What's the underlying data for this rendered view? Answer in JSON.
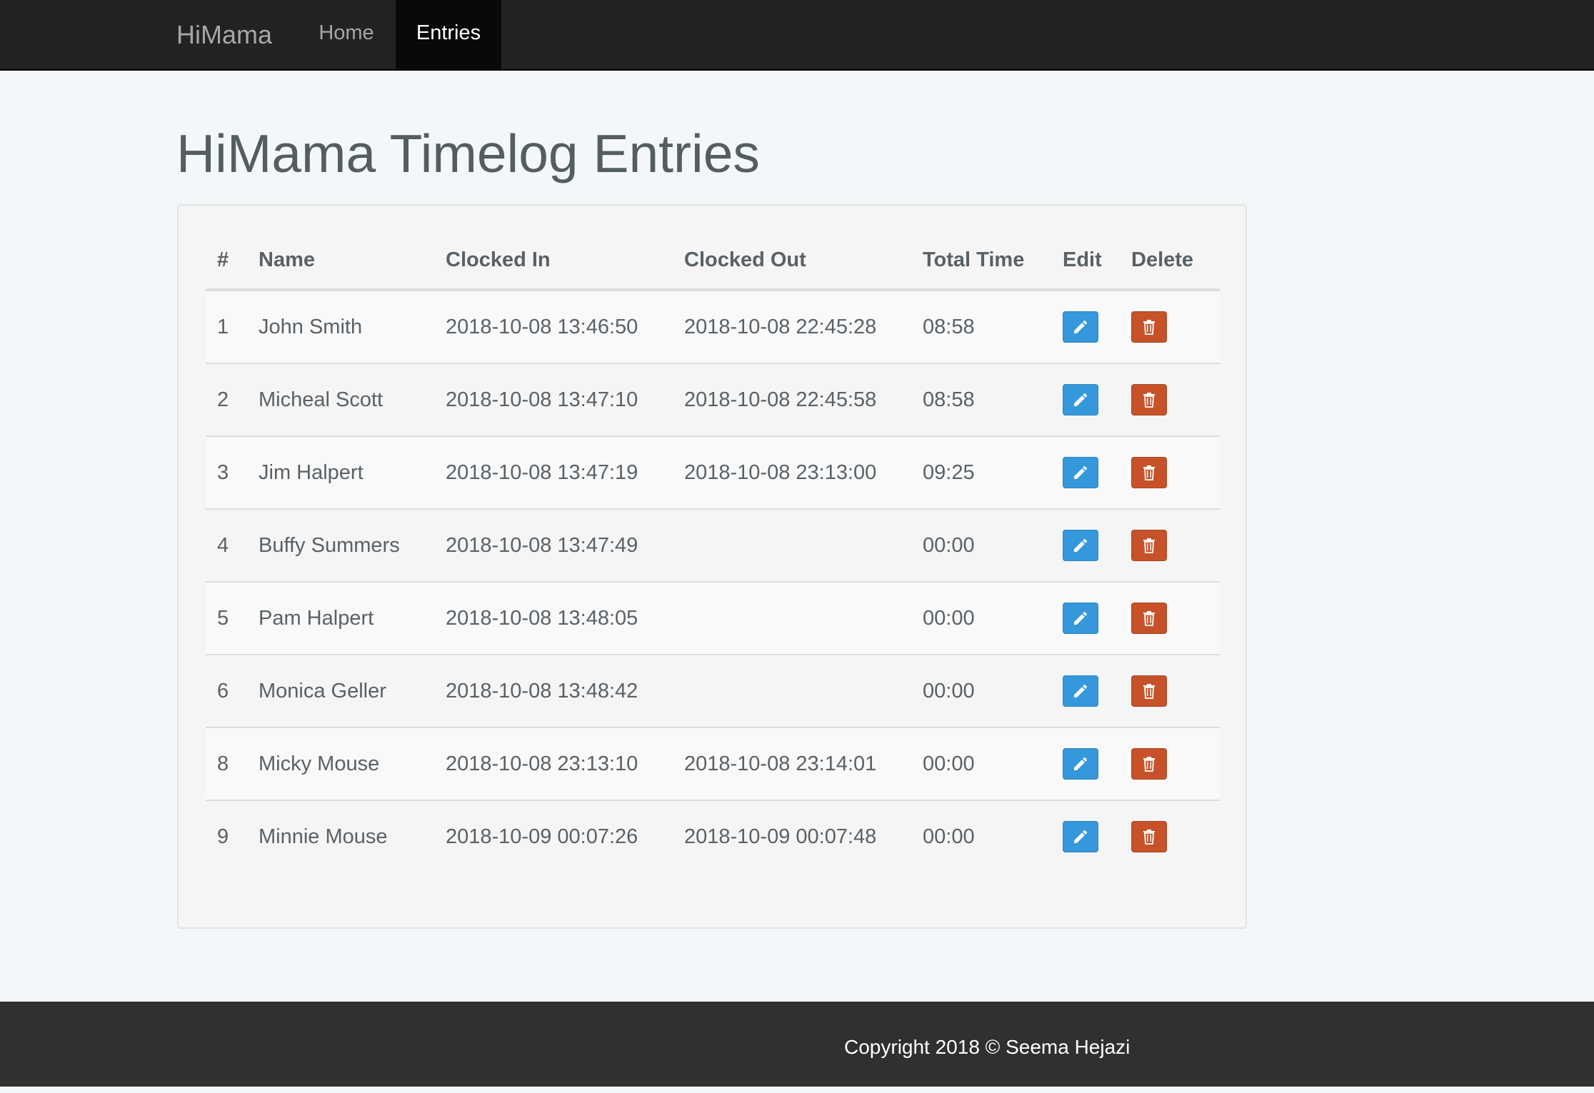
{
  "navbar": {
    "brand": "HiMama",
    "links": [
      {
        "label": "Home",
        "active": false
      },
      {
        "label": "Entries",
        "active": true
      }
    ]
  },
  "page": {
    "title": "HiMama Timelog Entries"
  },
  "table": {
    "columns": [
      "#",
      "Name",
      "Clocked In",
      "Clocked Out",
      "Total Time",
      "Edit",
      "Delete"
    ],
    "rows": [
      {
        "id": "1",
        "name": "John Smith",
        "clocked_in": "2018-10-08 13:46:50",
        "clocked_out": "2018-10-08 22:45:28",
        "total": "08:58"
      },
      {
        "id": "2",
        "name": "Micheal Scott",
        "clocked_in": "2018-10-08 13:47:10",
        "clocked_out": "2018-10-08 22:45:58",
        "total": "08:58"
      },
      {
        "id": "3",
        "name": "Jim Halpert",
        "clocked_in": "2018-10-08 13:47:19",
        "clocked_out": "2018-10-08 23:13:00",
        "total": "09:25"
      },
      {
        "id": "4",
        "name": "Buffy Summers",
        "clocked_in": "2018-10-08 13:47:49",
        "clocked_out": "",
        "total": "00:00"
      },
      {
        "id": "5",
        "name": "Pam Halpert",
        "clocked_in": "2018-10-08 13:48:05",
        "clocked_out": "",
        "total": "00:00"
      },
      {
        "id": "6",
        "name": "Monica Geller",
        "clocked_in": "2018-10-08 13:48:42",
        "clocked_out": "",
        "total": "00:00"
      },
      {
        "id": "8",
        "name": "Micky Mouse",
        "clocked_in": "2018-10-08 23:13:10",
        "clocked_out": "2018-10-08 23:14:01",
        "total": "00:00"
      },
      {
        "id": "9",
        "name": "Minnie Mouse",
        "clocked_in": "2018-10-09 00:07:26",
        "clocked_out": "2018-10-09 00:07:48",
        "total": "00:00"
      }
    ],
    "edit_icon": "pencil-icon",
    "delete_icon": "trash-icon"
  },
  "colors": {
    "navbar": "#222222",
    "edit_button": "#3498db",
    "delete_button": "#c7522a",
    "footer": "#303030"
  },
  "footer": {
    "text": "Copyright 2018 © Seema Hejazi"
  }
}
